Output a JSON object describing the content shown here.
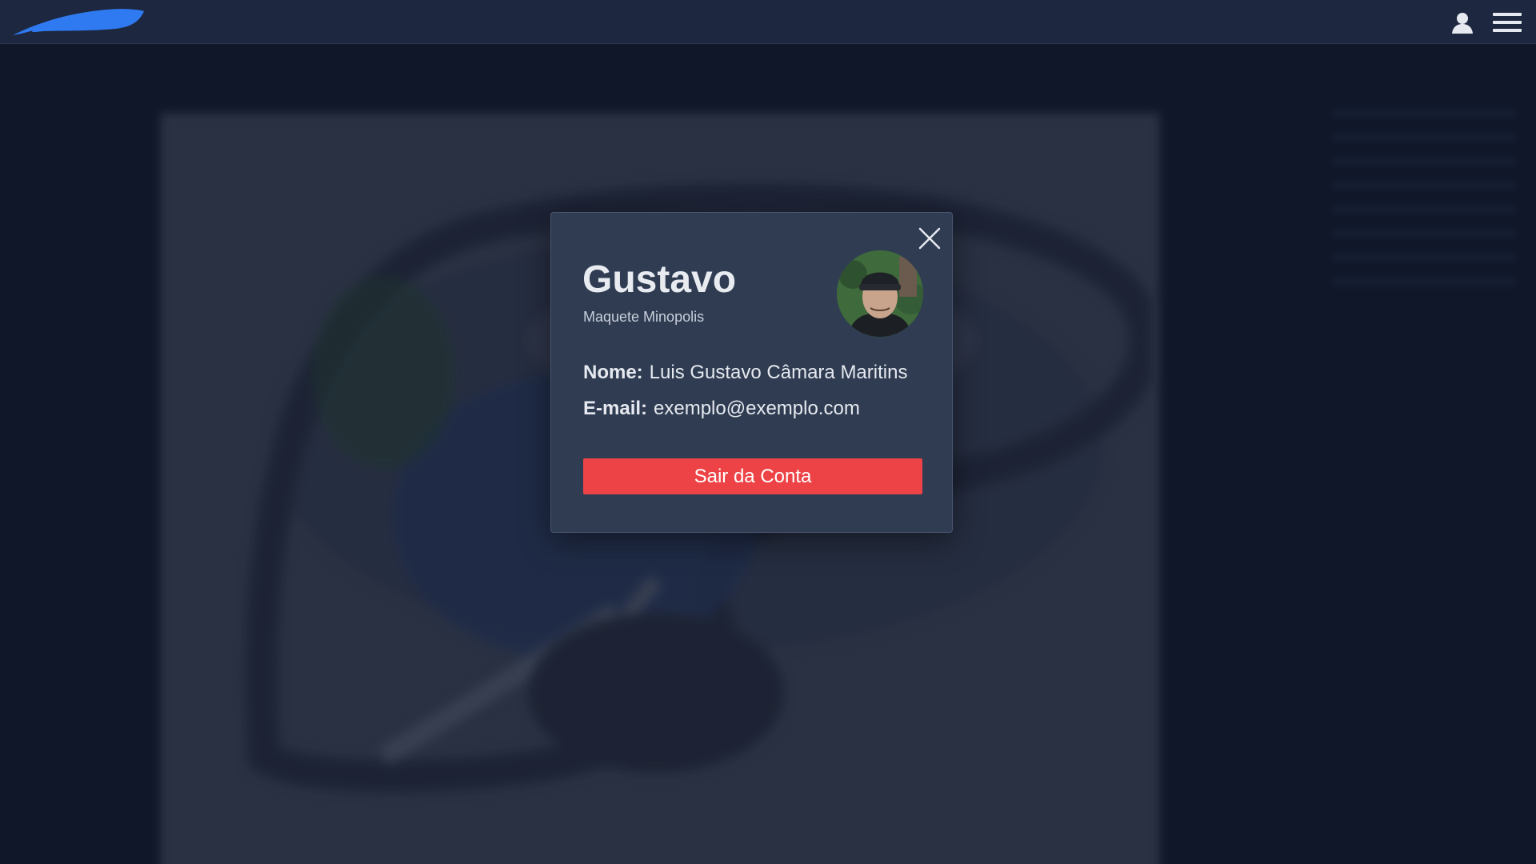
{
  "header": {
    "logo_icon": "swoosh-logo-icon",
    "user_icon": "user-icon",
    "menu_icon": "hamburger-menu-icon"
  },
  "profile_modal": {
    "display_name": "Gustavo",
    "subtitle": "Maquete Minopolis",
    "name_label": "Nome:",
    "name_value": "Luis Gustavo Câmara Maritins",
    "email_label": "E-mail:",
    "email_value": "exemplo@exemplo.com",
    "logout_label": "Sair da Conta",
    "close_icon": "close-icon",
    "avatar_icon": "avatar"
  },
  "colors": {
    "background": "#111a2e",
    "topbar": "#1d2740",
    "modal": "#2f3c52",
    "accent_blue": "#2f7af0",
    "danger": "#ee4346"
  }
}
